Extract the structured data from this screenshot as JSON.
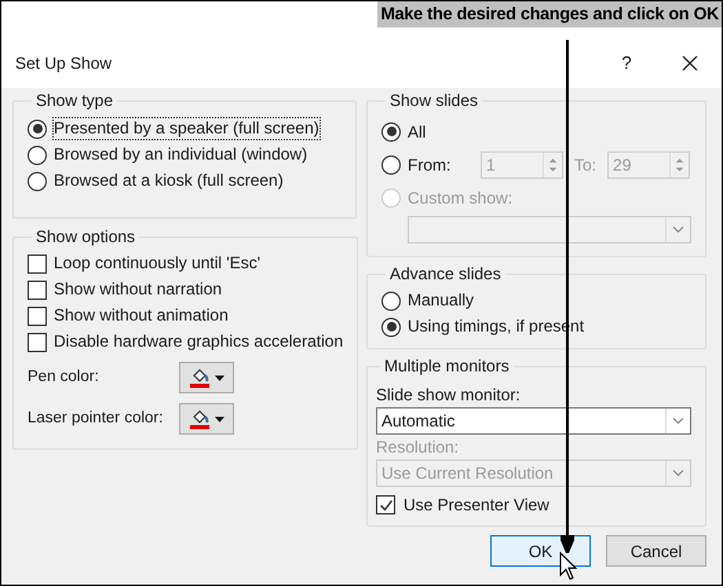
{
  "annotation": {
    "text": "Make the desired changes and click on OK"
  },
  "window": {
    "title": "Set Up Show",
    "help": "?"
  },
  "show_type": {
    "title": "Show type",
    "options": [
      {
        "label": "Presented by a speaker (full screen)",
        "selected": true,
        "focused": true
      },
      {
        "label": "Browsed by an individual (window)",
        "selected": false,
        "focused": false
      },
      {
        "label": "Browsed at a kiosk (full screen)",
        "selected": false,
        "focused": false
      }
    ]
  },
  "show_options": {
    "title": "Show options",
    "checkboxes": [
      {
        "label": "Loop continuously until 'Esc'",
        "checked": false
      },
      {
        "label": "Show without narration",
        "checked": false
      },
      {
        "label": "Show without animation",
        "checked": false
      },
      {
        "label": "Disable hardware graphics acceleration",
        "checked": false
      }
    ],
    "colors": [
      {
        "label": "Pen color:",
        "color": "#e00000"
      },
      {
        "label": "Laser pointer color:",
        "color": "#e00000"
      }
    ]
  },
  "show_slides": {
    "title": "Show slides",
    "options": [
      {
        "label": "All",
        "selected": true,
        "disabled": false
      },
      {
        "label": "From:",
        "selected": false,
        "disabled": false
      },
      {
        "label": "Custom show:",
        "selected": false,
        "disabled": true
      }
    ],
    "range": {
      "from_value": "1",
      "to_label": "To:",
      "to_value": "29",
      "disabled": true
    },
    "custom_show": {
      "disabled": true
    }
  },
  "advance_slides": {
    "title": "Advance slides",
    "options": [
      {
        "label": "Manually",
        "selected": false
      },
      {
        "label": "Using timings, if present",
        "selected": true
      }
    ]
  },
  "multiple_monitors": {
    "title": "Multiple monitors",
    "monitor_label": "Slide show monitor:",
    "monitor_value": "Automatic",
    "resolution_label": "Resolution:",
    "resolution_value": "Use Current Resolution",
    "resolution_disabled": true,
    "presenter_view": {
      "label": "Use Presenter View",
      "checked": true
    }
  },
  "buttons": [
    {
      "label": "OK",
      "kind": "default"
    },
    {
      "label": "Cancel",
      "kind": "normal"
    }
  ]
}
